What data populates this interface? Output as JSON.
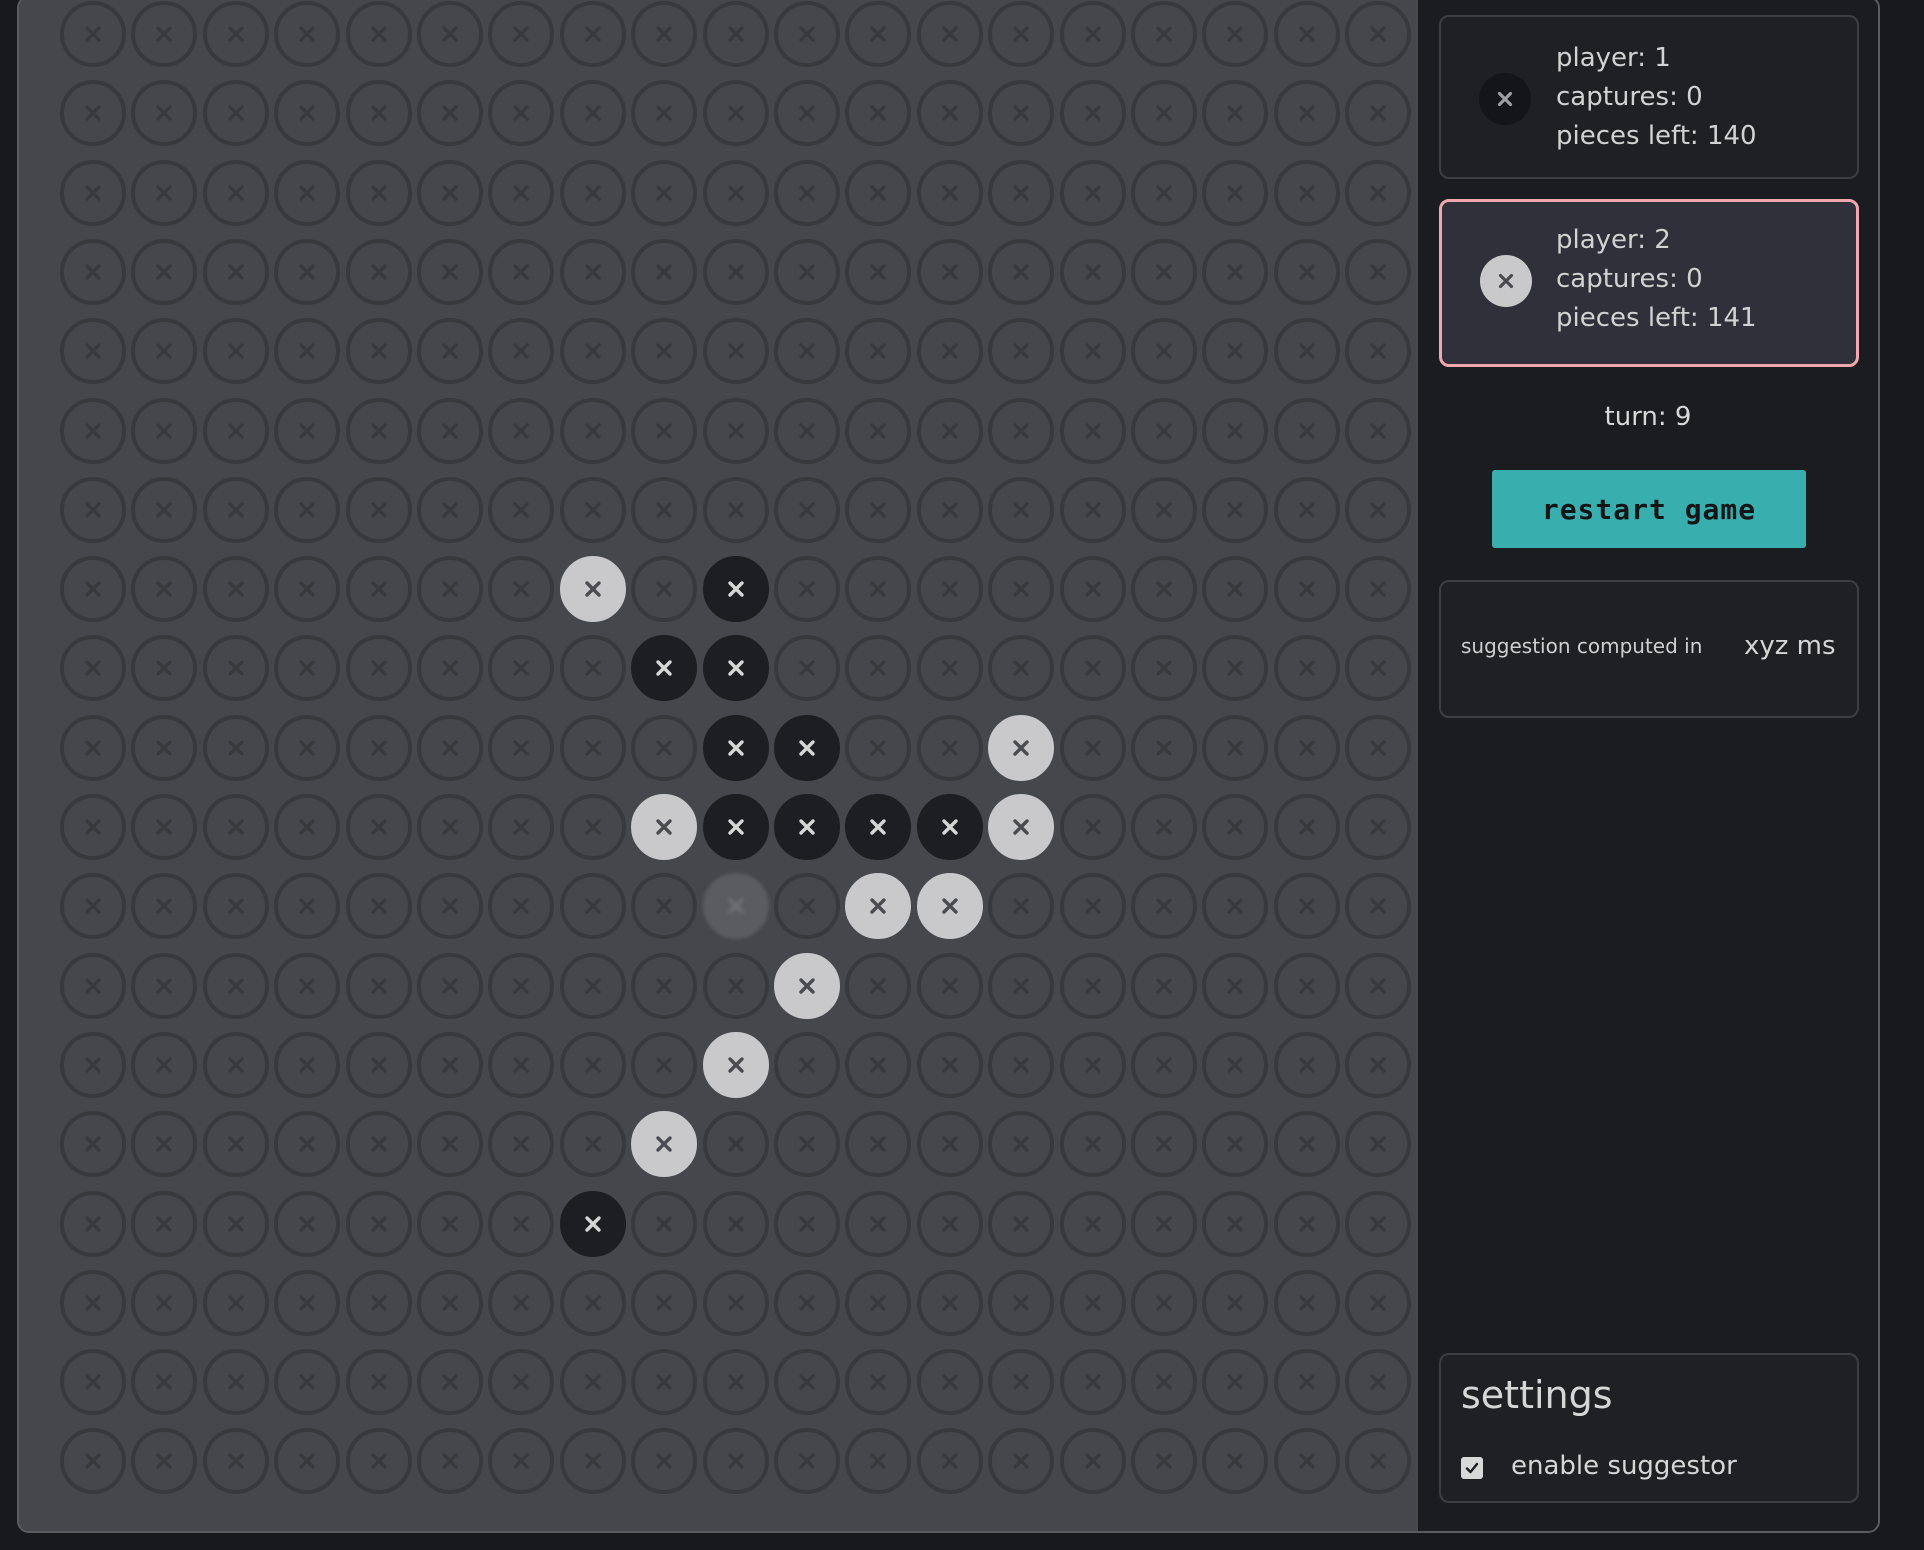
{
  "board": {
    "rows": 19,
    "cols": 19,
    "pieces": [
      {
        "row": 7,
        "col": 7,
        "player": 2
      },
      {
        "row": 7,
        "col": 9,
        "player": 1
      },
      {
        "row": 8,
        "col": 8,
        "player": 1
      },
      {
        "row": 8,
        "col": 9,
        "player": 1
      },
      {
        "row": 9,
        "col": 9,
        "player": 1
      },
      {
        "row": 9,
        "col": 10,
        "player": 1
      },
      {
        "row": 9,
        "col": 13,
        "player": 2
      },
      {
        "row": 10,
        "col": 8,
        "player": 2
      },
      {
        "row": 10,
        "col": 9,
        "player": 1
      },
      {
        "row": 10,
        "col": 10,
        "player": 1
      },
      {
        "row": 10,
        "col": 11,
        "player": 1
      },
      {
        "row": 10,
        "col": 12,
        "player": 1
      },
      {
        "row": 10,
        "col": 13,
        "player": 2
      },
      {
        "row": 11,
        "col": 11,
        "player": 2
      },
      {
        "row": 11,
        "col": 12,
        "player": 2
      },
      {
        "row": 12,
        "col": 10,
        "player": 2
      },
      {
        "row": 13,
        "col": 9,
        "player": 2
      },
      {
        "row": 14,
        "col": 8,
        "player": 2
      },
      {
        "row": 15,
        "col": 7,
        "player": 1
      }
    ],
    "suggestion": {
      "row": 11,
      "col": 9
    }
  },
  "players": [
    {
      "player": "player: 1",
      "captures": "captures: 0",
      "pieces_left": "pieces left: 140",
      "color": "#141518"
    },
    {
      "player": "player: 2",
      "captures": "captures: 0",
      "pieces_left": "pieces left: 141",
      "color": "#c9c9cb",
      "active": true
    }
  ],
  "turn": "turn: 9",
  "restart_label": "restart game",
  "suggestion": {
    "label": "suggestion computed in",
    "value": "xyz ms"
  },
  "settings": {
    "title": "settings",
    "enable_suggestor_label": "enable suggestor",
    "enable_suggestor": true
  },
  "colors": {
    "accent": "#39aeae",
    "active_border": "#f0a7ae",
    "board": "#45474c"
  }
}
